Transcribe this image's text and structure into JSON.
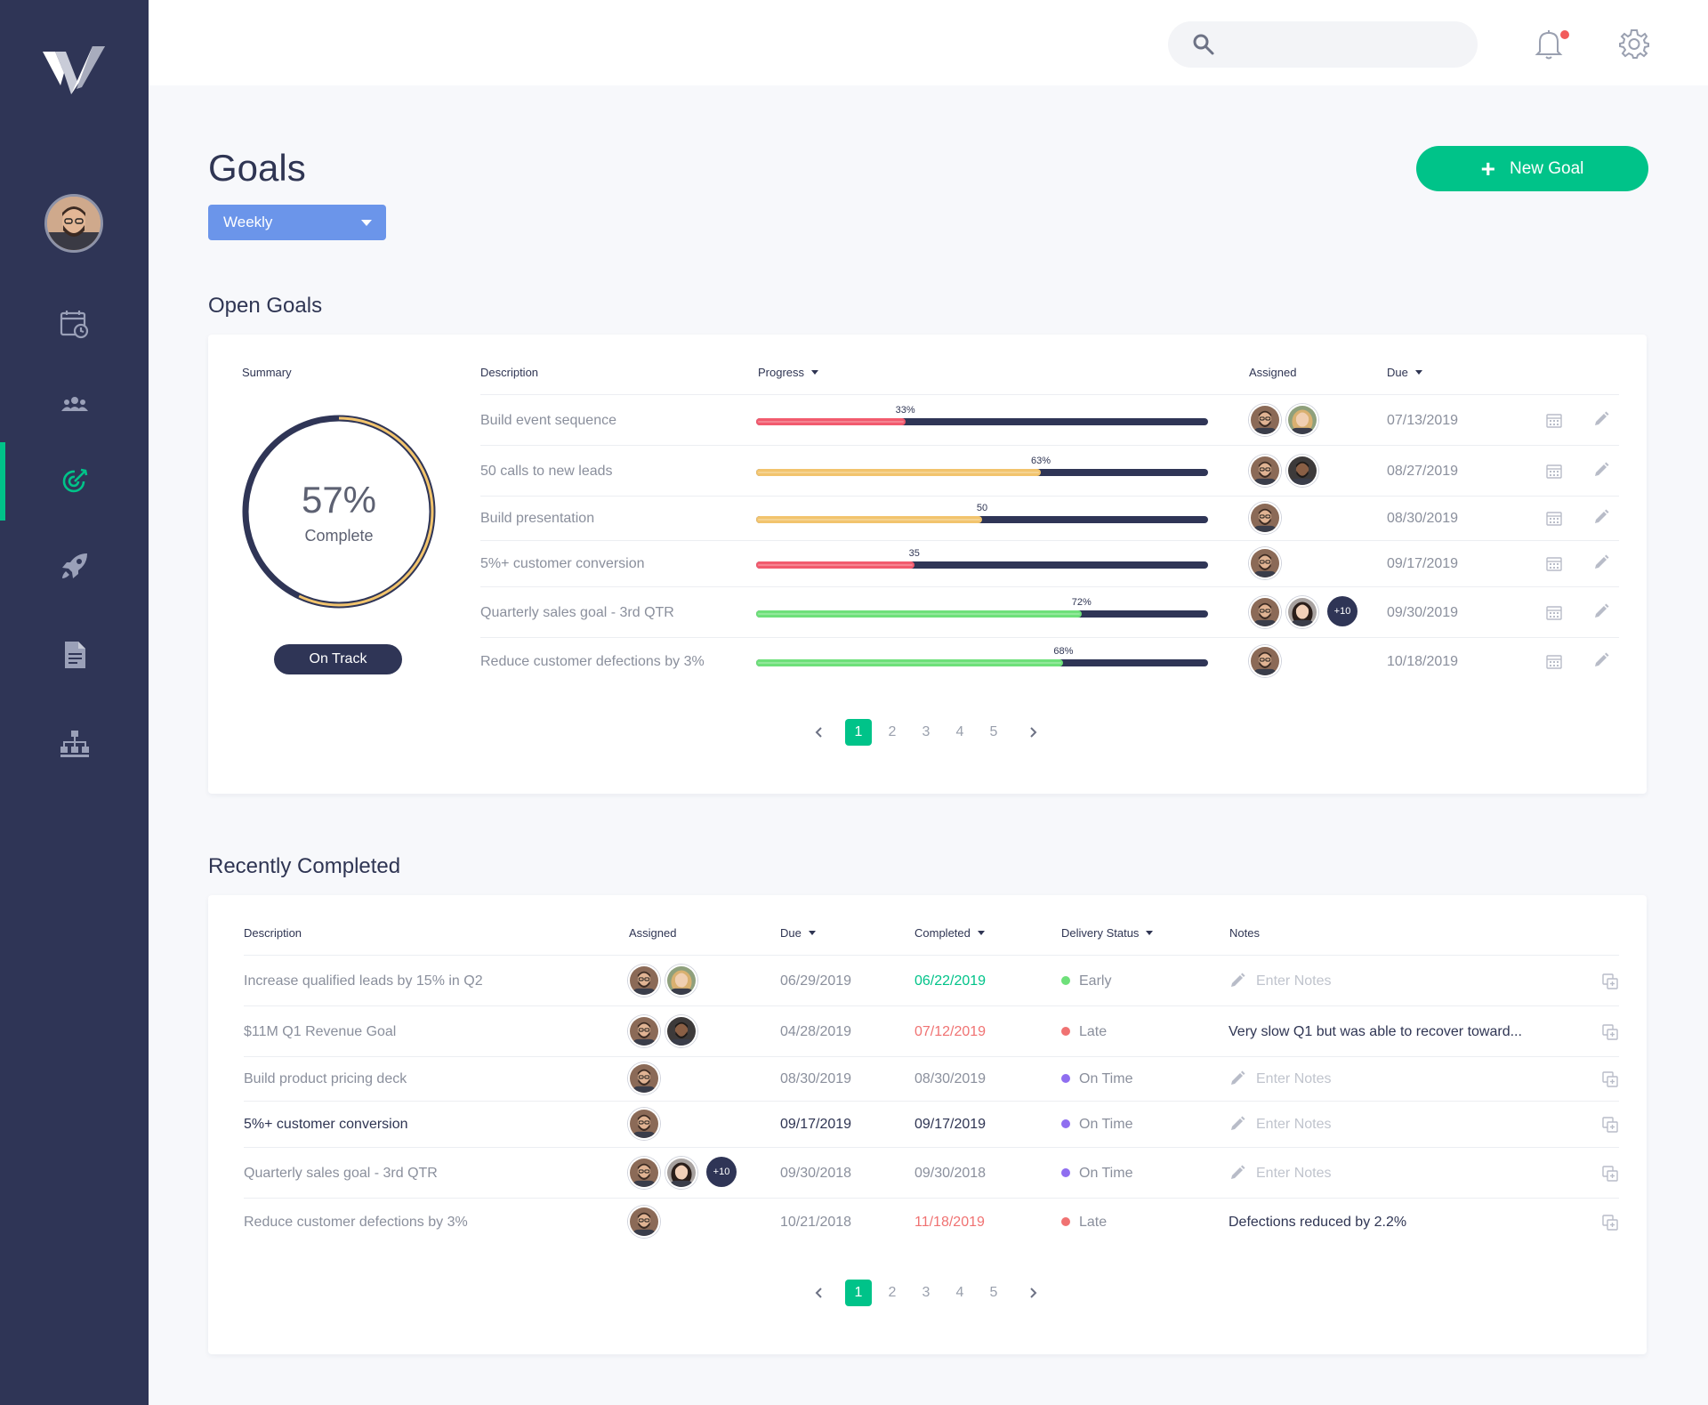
{
  "colors": {
    "sidebar": "#2f3556",
    "accent": "#00c389",
    "select": "#6b95ea",
    "bar_red": "#f25b6e",
    "bar_yellow": "#f2c46d",
    "bar_green": "#6ee07a",
    "early": "#6ee07a",
    "late": "#f07272",
    "on_time": "#8f6ef0"
  },
  "sidebar": {
    "items": [
      {
        "icon": "calendar-clock-icon"
      },
      {
        "icon": "team-icon"
      },
      {
        "icon": "target-icon",
        "active": true
      },
      {
        "icon": "rocket-icon"
      },
      {
        "icon": "document-icon"
      },
      {
        "icon": "org-chart-icon"
      }
    ]
  },
  "topbar": {
    "search_placeholder": "",
    "icons": [
      "search-icon",
      "bell-icon",
      "gear-icon"
    ]
  },
  "header": {
    "title": "Goals",
    "period": "Weekly",
    "new_goal_label": "New Goal"
  },
  "open_goals": {
    "title": "Open Goals",
    "columns": {
      "summary": "Summary",
      "description": "Description",
      "progress": "Progress",
      "assigned": "Assigned",
      "due": "Due"
    },
    "summary": {
      "percent": 57,
      "percent_label": "57%",
      "label": "Complete",
      "status": "On Track"
    },
    "rows": [
      {
        "description": "Build event sequence",
        "progress": 33,
        "progress_label": "33%",
        "color": "bar_red",
        "assigned": [
          "man-beard",
          "woman-blonde"
        ],
        "more": "",
        "due": "07/13/2019"
      },
      {
        "description": "50 calls to new leads",
        "progress": 63,
        "progress_label": "63%",
        "color": "bar_yellow",
        "assigned": [
          "man-beard",
          "man-dark"
        ],
        "more": "",
        "due": "08/27/2019"
      },
      {
        "description": "Build presentation",
        "progress": 50,
        "progress_label": "50",
        "color": "bar_yellow",
        "assigned": [
          "man-beard"
        ],
        "more": "",
        "due": "08/30/2019"
      },
      {
        "description": "5%+ customer conversion",
        "progress": 35,
        "progress_label": "35",
        "color": "bar_red",
        "assigned": [
          "man-beard"
        ],
        "more": "",
        "due": "09/17/2019"
      },
      {
        "description": "Quarterly sales goal - 3rd QTR",
        "progress": 72,
        "progress_label": "72%",
        "color": "bar_green",
        "assigned": [
          "man-beard",
          "woman-brunette"
        ],
        "more": "+10",
        "due": "09/30/2019"
      },
      {
        "description": "Reduce customer defections by 3%",
        "progress": 68,
        "progress_label": "68%",
        "color": "bar_green",
        "assigned": [
          "man-beard"
        ],
        "more": "",
        "due": "10/18/2019"
      }
    ],
    "pagination": {
      "pages": [
        "1",
        "2",
        "3",
        "4",
        "5"
      ],
      "active": "1"
    }
  },
  "recently_completed": {
    "title": "Recently Completed",
    "columns": {
      "description": "Description",
      "assigned": "Assigned",
      "due": "Due",
      "completed": "Completed",
      "delivery_status": "Delivery Status",
      "notes": "Notes"
    },
    "rows": [
      {
        "description": "Increase qualified leads by 15% in Q2",
        "assigned": [
          "man-beard",
          "woman-blonde"
        ],
        "more": "",
        "due": "06/29/2019",
        "completed": "06/22/2019",
        "completed_tone": "green",
        "status": "Early",
        "status_color": "early",
        "notes": "",
        "notes_placeholder": "Enter Notes",
        "dark": false
      },
      {
        "description": "$11M Q1 Revenue Goal",
        "assigned": [
          "man-beard",
          "man-dark"
        ],
        "more": "",
        "due": "04/28/2019",
        "completed": "07/12/2019",
        "completed_tone": "red",
        "status": "Late",
        "status_color": "late",
        "notes": "Very slow Q1 but was able to recover toward...",
        "notes_placeholder": "",
        "dark": false
      },
      {
        "description": "Build product pricing deck",
        "assigned": [
          "man-beard"
        ],
        "more": "",
        "due": "08/30/2019",
        "completed": "08/30/2019",
        "completed_tone": "normal",
        "status": "On Time",
        "status_color": "on_time",
        "notes": "",
        "notes_placeholder": "Enter Notes",
        "dark": false
      },
      {
        "description": "5%+ customer conversion",
        "assigned": [
          "man-beard"
        ],
        "more": "",
        "due": "09/17/2019",
        "completed": "09/17/2019",
        "completed_tone": "normal",
        "status": "On Time",
        "status_color": "on_time",
        "notes": "",
        "notes_placeholder": "Enter Notes",
        "dark": true
      },
      {
        "description": "Quarterly sales goal - 3rd QTR",
        "assigned": [
          "man-beard",
          "woman-brunette"
        ],
        "more": "+10",
        "due": "09/30/2018",
        "completed": "09/30/2018",
        "completed_tone": "normal",
        "status": "On Time",
        "status_color": "on_time",
        "notes": "",
        "notes_placeholder": "Enter Notes",
        "dark": false
      },
      {
        "description": "Reduce customer defections by 3%",
        "assigned": [
          "man-beard"
        ],
        "more": "",
        "due": "10/21/2018",
        "completed": "11/18/2019",
        "completed_tone": "red",
        "status": "Late",
        "status_color": "late",
        "notes": "Defections reduced by 2.2%",
        "notes_placeholder": "",
        "dark": false
      }
    ],
    "pagination": {
      "pages": [
        "1",
        "2",
        "3",
        "4",
        "5"
      ],
      "active": "1"
    }
  }
}
